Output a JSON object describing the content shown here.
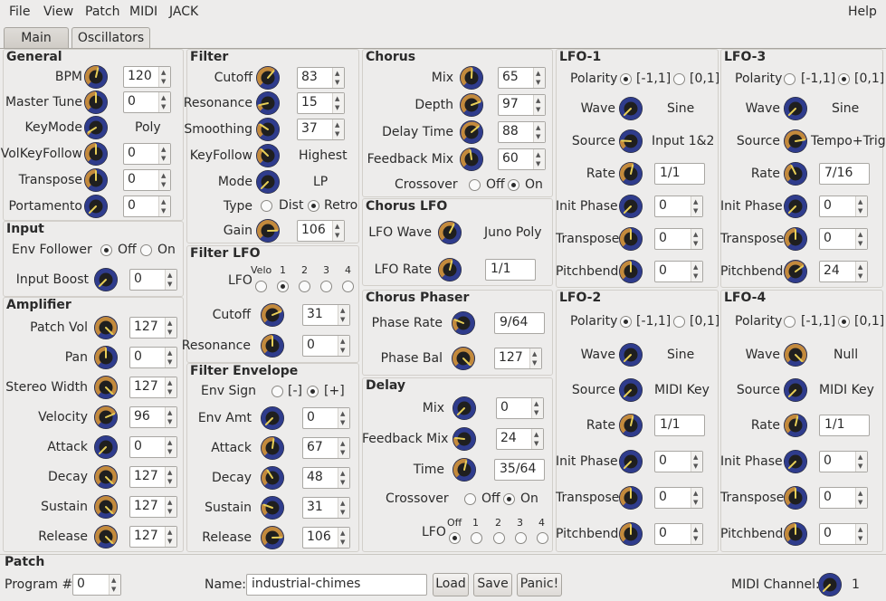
{
  "colors": {
    "knob_body": "#1f1f1f",
    "knob_ring": "#2f3c8c",
    "knob_face": "#c38a3c",
    "indicator": "#e8cf57"
  },
  "menu": {
    "file": "File",
    "view": "View",
    "patch": "Patch",
    "midi": "MIDI",
    "jack": "JACK",
    "help": "Help"
  },
  "tabs": {
    "main": "Main",
    "oscillators": "Oscillators"
  },
  "general": {
    "title": "General",
    "bpm_label": "BPM",
    "bpm": "120",
    "master_tune_label": "Master Tune",
    "master_tune": "0",
    "keymode_label": "KeyMode",
    "keymode": "Poly",
    "volkey_label": "VolKeyFollow",
    "volkey": "0",
    "transpose_label": "Transpose",
    "transpose": "0",
    "portamento_label": "Portamento",
    "portamento": "0"
  },
  "input": {
    "title": "Input",
    "env_follower_label": "Env Follower",
    "off": "Off",
    "on": "On",
    "boost_label": "Input Boost",
    "boost": "0"
  },
  "amp": {
    "title": "Amplifier",
    "patch_vol_label": "Patch Vol",
    "patch_vol": "127",
    "pan_label": "Pan",
    "pan": "0",
    "stereo_label": "Stereo Width",
    "stereo": "127",
    "velocity_label": "Velocity",
    "velocity": "96",
    "attack_label": "Attack",
    "attack": "0",
    "decay_label": "Decay",
    "decay": "127",
    "sustain_label": "Sustain",
    "sustain": "127",
    "release_label": "Release",
    "release": "127"
  },
  "filter": {
    "title": "Filter",
    "cutoff_label": "Cutoff",
    "cutoff": "83",
    "resonance_label": "Resonance",
    "resonance": "15",
    "smoothing_label": "Smoothing",
    "smoothing": "37",
    "keyfollow_label": "KeyFollow",
    "keyfollow": "Highest",
    "mode_label": "Mode",
    "mode": "LP",
    "type_label": "Type",
    "dist": "Dist",
    "retro": "Retro",
    "gain_label": "Gain",
    "gain": "106"
  },
  "filter_lfo": {
    "title": "Filter LFO",
    "lfo_label": "LFO",
    "velo": "Velo",
    "n1": "1",
    "n2": "2",
    "n3": "3",
    "n4": "4",
    "cutoff_label": "Cutoff",
    "cutoff": "31",
    "resonance_label": "Resonance",
    "resonance": "0"
  },
  "filter_env": {
    "title": "Filter Envelope",
    "sign_label": "Env Sign",
    "neg": "[-]",
    "pos": "[+]",
    "amt_label": "Env Amt",
    "amt": "0",
    "attack_label": "Attack",
    "attack": "67",
    "decay_label": "Decay",
    "decay": "48",
    "sustain_label": "Sustain",
    "sustain": "31",
    "release_label": "Release",
    "release": "106"
  },
  "chorus": {
    "title": "Chorus",
    "mix_label": "Mix",
    "mix": "65",
    "depth_label": "Depth",
    "depth": "97",
    "delay_label": "Delay Time",
    "delay": "88",
    "feedback_label": "Feedback Mix",
    "feedback": "60",
    "crossover_label": "Crossover",
    "off": "Off",
    "on": "On"
  },
  "chorus_lfo": {
    "title": "Chorus LFO",
    "wave_label": "LFO Wave",
    "wave": "Juno Poly",
    "rate_label": "LFO Rate",
    "rate": "1/1"
  },
  "chorus_phaser": {
    "title": "Chorus Phaser",
    "rate_label": "Phase Rate",
    "rate": "9/64",
    "bal_label": "Phase Bal",
    "bal": "127"
  },
  "delay": {
    "title": "Delay",
    "mix_label": "Mix",
    "mix": "0",
    "feedback_label": "Feedback Mix",
    "feedback": "24",
    "time_label": "Time",
    "time": "35/64",
    "crossover_label": "Crossover",
    "off": "Off",
    "on": "On",
    "lfo_label": "LFO",
    "lfo_off": "Off",
    "n1": "1",
    "n2": "2",
    "n3": "3",
    "n4": "4"
  },
  "lfo_labels": {
    "polarity": "Polarity",
    "bipolar": "[-1,1]",
    "unipolar": "[0,1]",
    "wave": "Wave",
    "source": "Source",
    "rate": "Rate",
    "init_phase": "Init Phase",
    "transpose": "Transpose",
    "pitchbend": "Pitchbend"
  },
  "lfo1": {
    "title": "LFO-1",
    "wave": "Sine",
    "source": "Input 1&2",
    "rate": "1/1",
    "init_phase": "0",
    "transpose": "0",
    "pitchbend": "0"
  },
  "lfo2": {
    "title": "LFO-2",
    "wave": "Sine",
    "source": "MIDI Key",
    "rate": "1/1",
    "init_phase": "0",
    "transpose": "0",
    "pitchbend": "0"
  },
  "lfo3": {
    "title": "LFO-3",
    "wave": "Sine",
    "source": "Tempo+Trig",
    "rate": "7/16",
    "init_phase": "0",
    "transpose": "0",
    "pitchbend": "24"
  },
  "lfo4": {
    "title": "LFO-4",
    "wave": "Null",
    "source": "MIDI Key",
    "rate": "1/1",
    "init_phase": "0",
    "transpose": "0",
    "pitchbend": "0"
  },
  "patch": {
    "title": "Patch",
    "program_label": "Program #:",
    "program": "0",
    "name_label": "Name:",
    "name": "industrial-chimes",
    "load": "Load",
    "save": "Save",
    "panic": "Panic!",
    "midi_channel_label": "MIDI Channel:",
    "midi_channel": "1"
  }
}
